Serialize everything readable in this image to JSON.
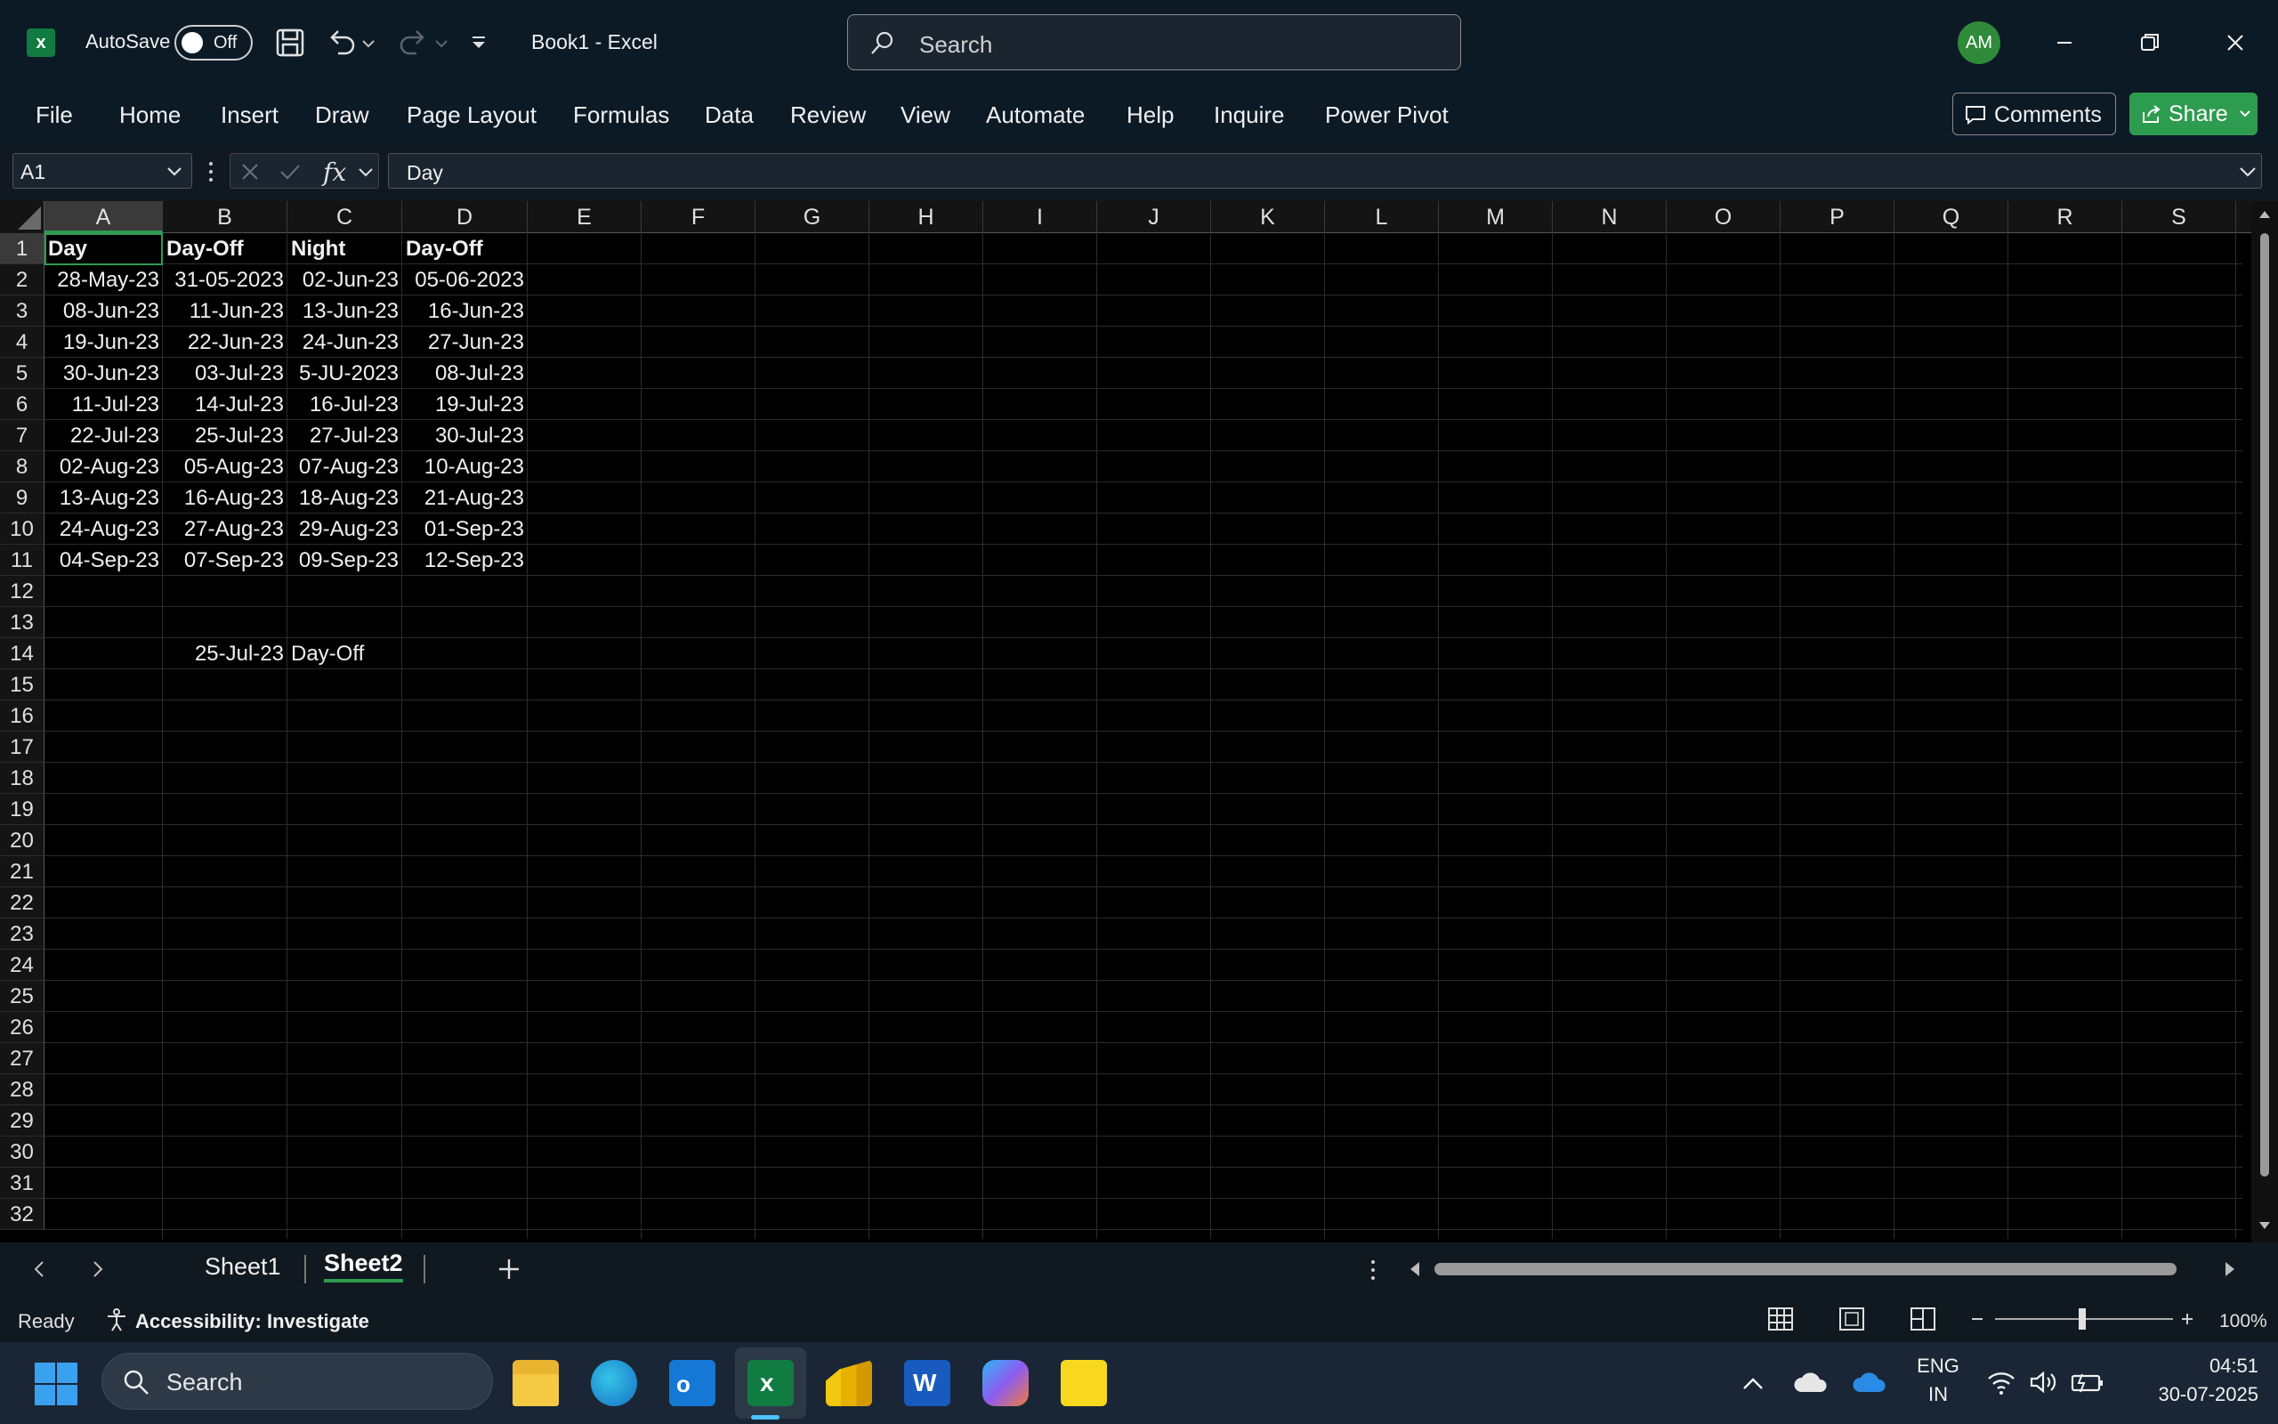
{
  "titlebar": {
    "autosave_label": "AutoSave",
    "autosave_state": "Off",
    "doc_title": "Book1  -  Excel",
    "search_placeholder": "Search",
    "avatar_initials": "AM"
  },
  "ribbon_tabs": [
    "File",
    "Home",
    "Insert",
    "Draw",
    "Page Layout",
    "Formulas",
    "Data",
    "Review",
    "View",
    "Automate",
    "Help",
    "Inquire",
    "Power Pivot"
  ],
  "ribbon_buttons": {
    "comments": "Comments",
    "share": "Share"
  },
  "formula_bar": {
    "name_box": "A1",
    "fx": "fx",
    "value": "Day"
  },
  "columns": [
    "A",
    "B",
    "C",
    "D",
    "E",
    "F",
    "G",
    "H",
    "I",
    "J",
    "K",
    "L",
    "M",
    "N",
    "O",
    "P",
    "Q",
    "R",
    "S"
  ],
  "rows": [
    "1",
    "2",
    "3",
    "4",
    "5",
    "6",
    "7",
    "8",
    "9",
    "10",
    "11",
    "12",
    "13",
    "14",
    "15",
    "16",
    "17",
    "18",
    "19",
    "20",
    "21",
    "22",
    "23",
    "24",
    "25",
    "26",
    "27",
    "28",
    "29",
    "30",
    "31",
    "32"
  ],
  "cells": {
    "r1": [
      "Day",
      "Day-Off",
      "Night",
      "Day-Off"
    ],
    "r2": [
      "28-May-23",
      "31-05-2023",
      "02-Jun-23",
      "05-06-2023"
    ],
    "r3": [
      "08-Jun-23",
      "11-Jun-23",
      "13-Jun-23",
      "16-Jun-23"
    ],
    "r4": [
      "19-Jun-23",
      "22-Jun-23",
      "24-Jun-23",
      "27-Jun-23"
    ],
    "r5": [
      "30-Jun-23",
      "03-Jul-23",
      "5-JU-2023",
      "08-Jul-23"
    ],
    "r6": [
      "11-Jul-23",
      "14-Jul-23",
      "16-Jul-23",
      "19-Jul-23"
    ],
    "r7": [
      "22-Jul-23",
      "25-Jul-23",
      "27-Jul-23",
      "30-Jul-23"
    ],
    "r8": [
      "02-Aug-23",
      "05-Aug-23",
      "07-Aug-23",
      "10-Aug-23"
    ],
    "r9": [
      "13-Aug-23",
      "16-Aug-23",
      "18-Aug-23",
      "21-Aug-23"
    ],
    "r10": [
      "24-Aug-23",
      "27-Aug-23",
      "29-Aug-23",
      "01-Sep-23"
    ],
    "r11": [
      "04-Sep-23",
      "07-Sep-23",
      "09-Sep-23",
      "12-Sep-23"
    ],
    "r14": [
      "",
      "25-Jul-23",
      "Day-Off",
      ""
    ]
  },
  "sheets": [
    "Sheet1",
    "Sheet2"
  ],
  "active_sheet": "Sheet2",
  "status": {
    "ready": "Ready",
    "accessibility": "Accessibility: Investigate",
    "zoom": "100%"
  },
  "taskbar": {
    "search_placeholder": "Search",
    "lang_1": "ENG",
    "lang_2": "IN",
    "time": "04:51",
    "date": "30-07-2025"
  },
  "colors": {
    "accent": "#2e9c4f",
    "excel_green": "#107c41"
  }
}
